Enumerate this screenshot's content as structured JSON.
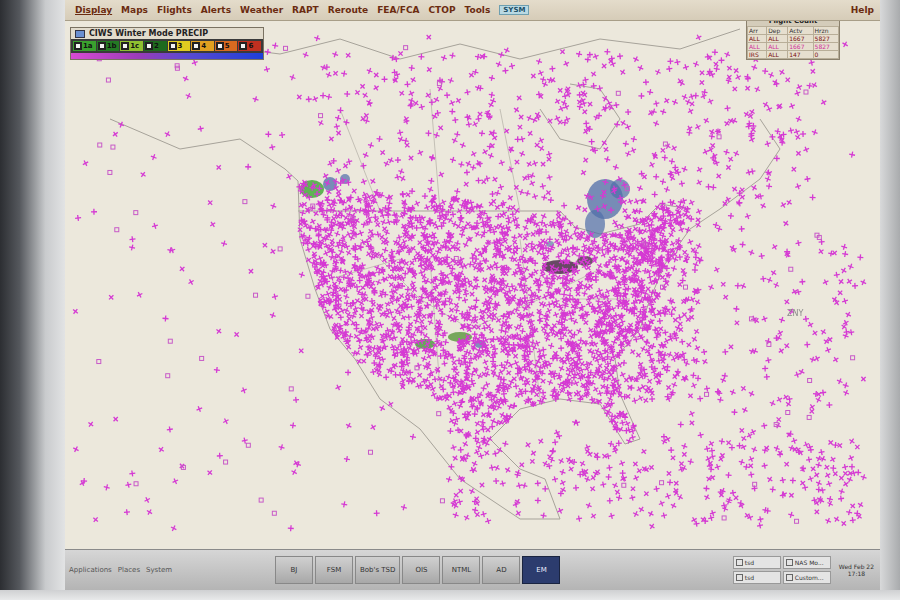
{
  "menu": {
    "items": [
      {
        "label": "Display"
      },
      {
        "label": "Maps"
      },
      {
        "label": "Flights"
      },
      {
        "label": "Alerts"
      },
      {
        "label": "Weather"
      },
      {
        "label": "RAPT"
      },
      {
        "label": "Reroute"
      },
      {
        "label": "FEA/FCA"
      },
      {
        "label": "CTOP"
      },
      {
        "label": "Tools"
      }
    ],
    "badge": "SYSM",
    "help": "Help"
  },
  "legend": {
    "title": "CIWS Winter Mode PRECIP",
    "levels": [
      {
        "label": "1a",
        "checked": true,
        "color": "#3aa02e"
      },
      {
        "label": "1b",
        "checked": true,
        "color": "#247a24"
      },
      {
        "label": "1c",
        "checked": true,
        "color": "#8fbf30"
      },
      {
        "label": "2",
        "checked": true,
        "color": "#1e6a1e"
      },
      {
        "label": "3",
        "checked": true,
        "color": "#e0cc20"
      },
      {
        "label": "4",
        "checked": true,
        "color": "#e0a020"
      },
      {
        "label": "5",
        "checked": true,
        "color": "#d86a20"
      },
      {
        "label": "6",
        "checked": true,
        "color": "#c03020"
      }
    ]
  },
  "flight_count": {
    "title": "Flight Count",
    "columns": [
      "Arr",
      "Dep",
      "Actv",
      "Hrzn"
    ],
    "rows": [
      {
        "cells": [
          "ALL",
          "ALL",
          "1667",
          "5827"
        ],
        "color": "#7a1010"
      },
      {
        "cells": [
          "ALL",
          "ALL",
          "1667",
          "5827"
        ],
        "color": "#d0309a"
      },
      {
        "cells": [
          "IRS",
          "ALL",
          "147",
          "0"
        ],
        "color": "#7a1010"
      }
    ]
  },
  "map": {
    "labels": [
      {
        "text": "ZNY"
      }
    ]
  },
  "taskbar": {
    "menus": [
      "Applications",
      "Places",
      "System"
    ],
    "buttons": [
      {
        "label": "BJ",
        "selected": false
      },
      {
        "label": "FSM",
        "selected": false
      },
      {
        "label": "Bob's TSD",
        "selected": false
      },
      {
        "label": "OIS",
        "selected": false
      },
      {
        "label": "NTML",
        "selected": false
      },
      {
        "label": "AD",
        "selected": false
      },
      {
        "label": "EM",
        "selected": true
      }
    ],
    "windows": [
      {
        "label": "tsd"
      },
      {
        "label": "NAS Mo..."
      },
      {
        "label": "tsd"
      },
      {
        "label": "Custom..."
      }
    ],
    "clock": {
      "date": "Wed Feb 22",
      "time": "17:18"
    }
  }
}
